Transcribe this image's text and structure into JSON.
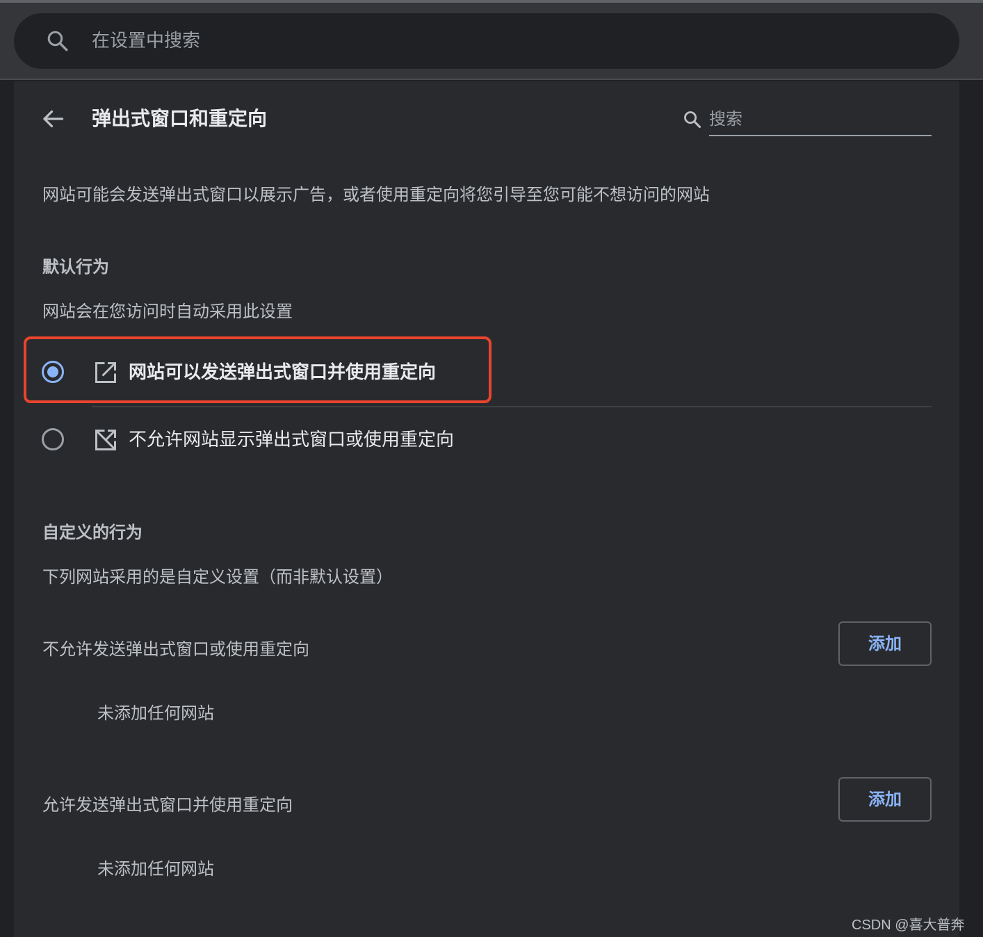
{
  "global_search": {
    "placeholder": "在设置中搜索",
    "icon": "search-icon"
  },
  "header": {
    "back_icon": "arrow-left-icon",
    "title": "弹出式窗口和重定向",
    "search_placeholder": "搜索",
    "search_icon": "search-icon"
  },
  "description": "网站可能会发送弹出式窗口以展示广告，或者使用重定向将您引导至您可能不想访问的网站",
  "default_behavior": {
    "heading": "默认行为",
    "subtitle": "网站会在您访问时自动采用此设置",
    "options": [
      {
        "label": "网站可以发送弹出式窗口并使用重定向",
        "selected": true,
        "icon": "open-in-new-icon"
      },
      {
        "label": "不允许网站显示弹出式窗口或使用重定向",
        "selected": false,
        "icon": "open-in-new-off-icon"
      }
    ]
  },
  "custom_behavior": {
    "heading": "自定义的行为",
    "subtitle": "下列网站采用的是自定义设置（而非默认设置）",
    "sections": [
      {
        "title": "不允许发送弹出式窗口或使用重定向",
        "button": "添加",
        "empty": "未添加任何网站"
      },
      {
        "title": "允许发送弹出式窗口并使用重定向",
        "button": "添加",
        "empty": "未添加任何网站"
      }
    ]
  },
  "watermark": "CSDN @喜大普奔",
  "colors": {
    "accent": "#8ab4f8",
    "highlight_box": "#e8442e",
    "card_bg": "#292a2d",
    "page_bg": "#202124"
  }
}
